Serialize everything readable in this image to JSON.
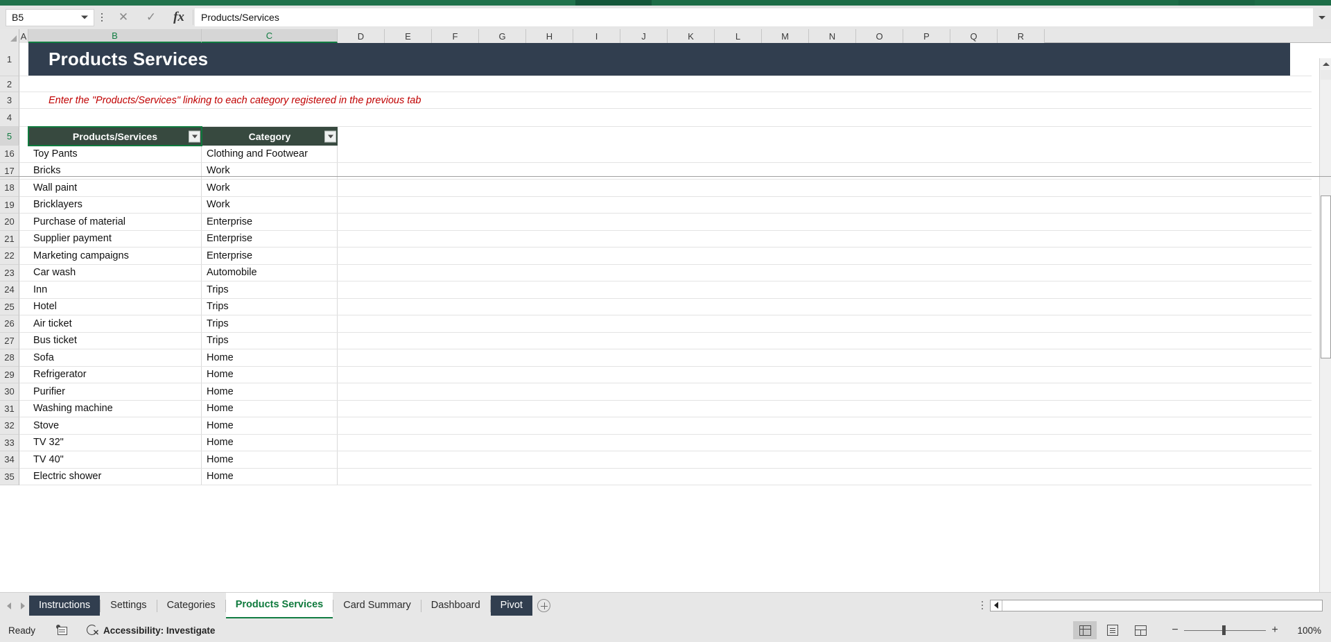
{
  "app": {
    "accent_green": "#107c41",
    "title_banner_color": "#313e4f",
    "table_header_color": "#37493f",
    "instruction_color": "#c00000"
  },
  "formula_bar": {
    "name_box_value": "B5",
    "cancel_icon": "close-icon",
    "confirm_icon": "check-icon",
    "function_icon": "fx",
    "formula_value": "Products/Services"
  },
  "grid": {
    "columns": [
      "A",
      "B",
      "C",
      "D",
      "E",
      "F",
      "G",
      "H",
      "I",
      "J",
      "K",
      "L",
      "M",
      "N",
      "O",
      "P",
      "Q",
      "R"
    ],
    "selected_columns": [
      "B",
      "C"
    ],
    "row_numbers_top": [
      "1",
      "2",
      "3",
      "4",
      "5"
    ],
    "row_numbers_data": [
      "16",
      "17",
      "18",
      "19",
      "20",
      "21",
      "22",
      "23",
      "24",
      "25",
      "26",
      "27",
      "28",
      "29",
      "30",
      "31",
      "32",
      "33",
      "34",
      "35"
    ],
    "selected_row": "5",
    "banner_title": "Products Services",
    "instruction": "Enter the \"Products/Services\" linking to each category registered in the previous tab",
    "table_headers": [
      "Products/Services",
      "Category"
    ],
    "rows": [
      {
        "product": "Toy Pants",
        "category": "Clothing and Footwear"
      },
      {
        "product": "Bricks",
        "category": "Work"
      },
      {
        "product": "Wall paint",
        "category": "Work"
      },
      {
        "product": "Bricklayers",
        "category": "Work"
      },
      {
        "product": "Purchase of material",
        "category": "Enterprise"
      },
      {
        "product": "Supplier payment",
        "category": "Enterprise"
      },
      {
        "product": "Marketing campaigns",
        "category": "Enterprise"
      },
      {
        "product": "Car wash",
        "category": "Automobile"
      },
      {
        "product": "Inn",
        "category": "Trips"
      },
      {
        "product": "Hotel",
        "category": "Trips"
      },
      {
        "product": "Air ticket",
        "category": "Trips"
      },
      {
        "product": "Bus ticket",
        "category": "Trips"
      },
      {
        "product": "Sofa",
        "category": "Home"
      },
      {
        "product": "Refrigerator",
        "category": "Home"
      },
      {
        "product": "Purifier",
        "category": "Home"
      },
      {
        "product": "Washing machine",
        "category": "Home"
      },
      {
        "product": "Stove",
        "category": "Home"
      },
      {
        "product": "TV 32\"",
        "category": "Home"
      },
      {
        "product": "TV 40\"",
        "category": "Home"
      },
      {
        "product": "Electric shower",
        "category": "Home"
      }
    ]
  },
  "sheet_tabs": {
    "items": [
      {
        "label": "Instructions",
        "state": "colored"
      },
      {
        "label": "Settings",
        "state": "normal"
      },
      {
        "label": "Categories",
        "state": "normal"
      },
      {
        "label": "Products Services",
        "state": "active"
      },
      {
        "label": "Card Summary",
        "state": "normal"
      },
      {
        "label": "Dashboard",
        "state": "normal"
      },
      {
        "label": "Pivot",
        "state": "colored"
      }
    ],
    "add_sheet_icon": "plus-circle-icon"
  },
  "status_bar": {
    "mode": "Ready",
    "macro_icon": "record-macro-icon",
    "accessibility_icon": "accessibility-icon",
    "accessibility": "Accessibility: Investigate",
    "view_normal_icon": "normal-view-icon",
    "view_page_layout_icon": "page-layout-icon",
    "view_page_break_icon": "page-break-preview-icon",
    "zoom_out_label": "−",
    "zoom_in_label": "+",
    "zoom_value": "100%"
  }
}
